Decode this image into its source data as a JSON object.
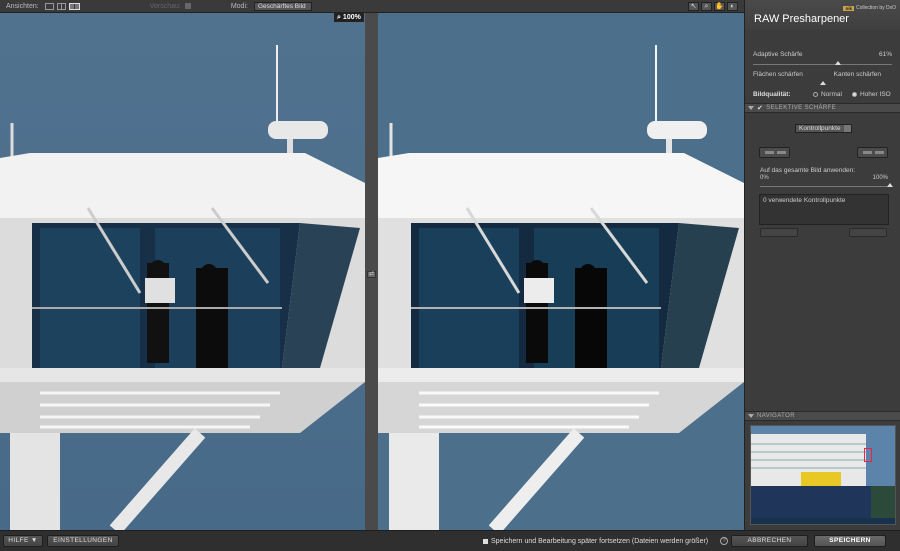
{
  "toolbar": {
    "view_label": "Ansichten:",
    "preview_label": "Vorschau:",
    "mode_label": "Modi:",
    "mode_value": "Geschärftes Bild",
    "zoom": "100%"
  },
  "panel": {
    "title": "RAW Presharpener",
    "brand_logo": "nik",
    "brand_text": "Collection by DxO",
    "sharpness_label": "Adaptive Schärfe",
    "sharpness_value": "61%",
    "sharpness_level": 0.61,
    "area_label": "Flächen schärfen",
    "edge_label": "Kanten schärfen",
    "edge_balance": 0.5,
    "quality_label": "Bildqualität:",
    "quality_normal": "Normal",
    "quality_iso": "Hoher ISO",
    "selective_title": "SELEKTIVE SCHÄRFE",
    "controlpoints_select": "Kontrollpunkte",
    "apply_label": "Auf das gesamte Bild anwenden:",
    "apply_min": "0%",
    "apply_max": "100%",
    "apply_level": 1.0,
    "cp_count_text": "0 verwendete Kontrollpunkte",
    "navigator_title": "NAVIGATOR"
  },
  "bottom": {
    "help": "HILFE ▼",
    "settings": "EINSTELLUNGEN",
    "save_later": "Speichern und Bearbeitung später fortsetzen (Dateien werden größer)",
    "help_icon": "?",
    "cancel": "ABBRECHEN",
    "save": "SPEICHERN"
  },
  "colors": {
    "sky": "#4c6f8c",
    "panel_bg": "#3c3c3c",
    "accent": "#c9a24a"
  }
}
